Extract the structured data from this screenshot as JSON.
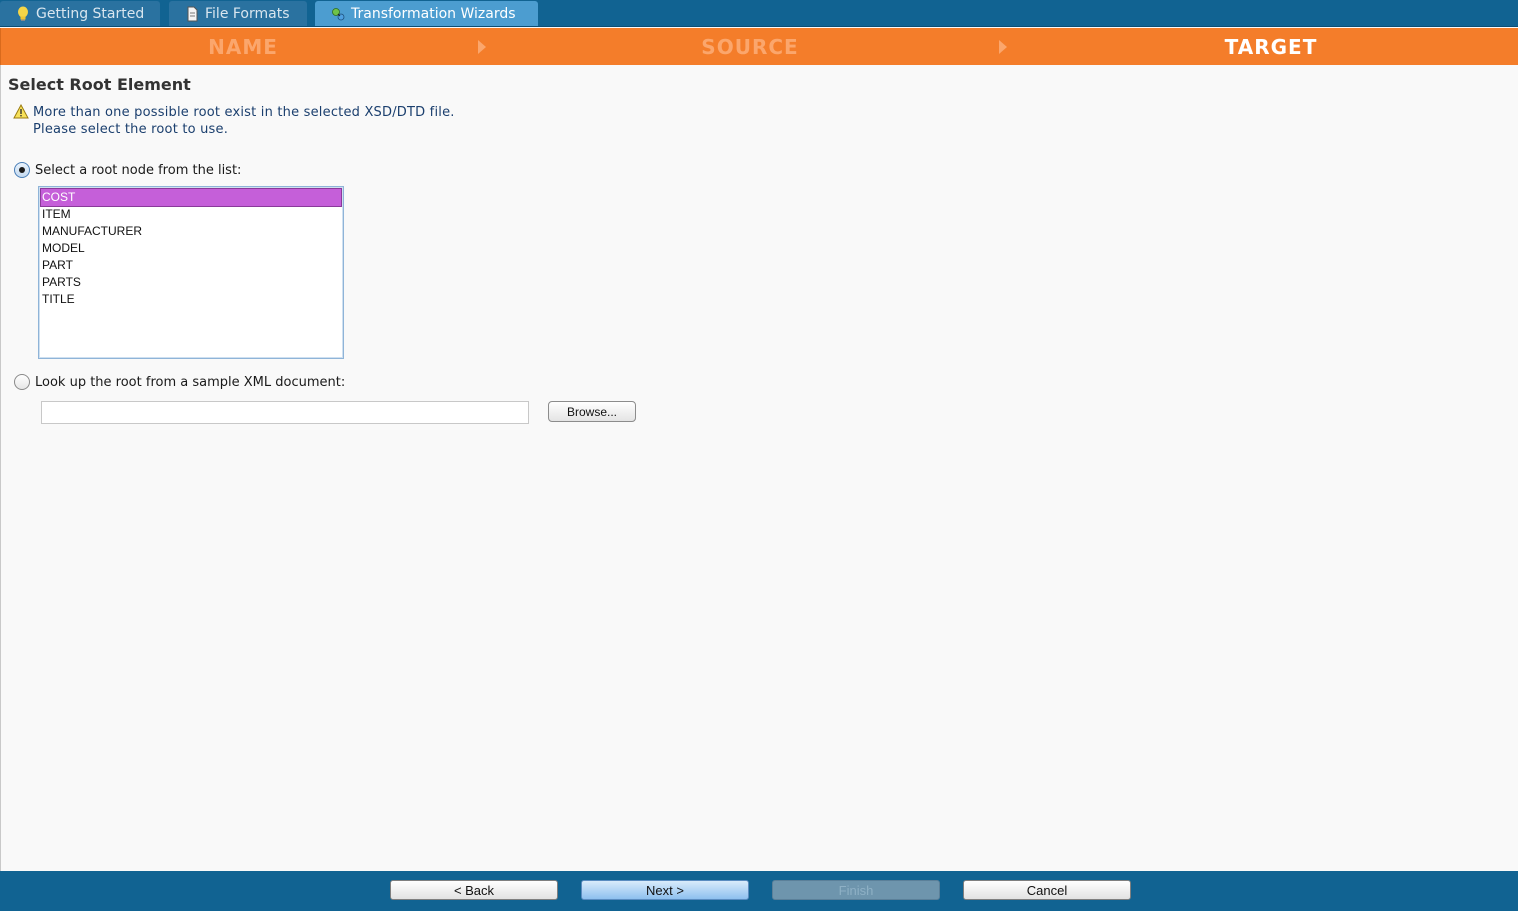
{
  "tabs": [
    {
      "label": "Getting Started",
      "icon": "lightbulb-icon"
    },
    {
      "label": "File Formats",
      "icon": "document-icon"
    },
    {
      "label": "Transformation Wizards",
      "icon": "wizard-icon",
      "active": true
    }
  ],
  "steps": {
    "name": "NAME",
    "source": "SOURCE",
    "target": "TARGET",
    "current": "TARGET"
  },
  "section": {
    "title": "Select Root Element",
    "warning_line1": "More than one possible root exist in the selected XSD/DTD file.",
    "warning_line2": "Please select the root to use."
  },
  "options": {
    "list_label": "Select a root node from the list:",
    "xml_label": "Look up the root from a sample XML document:",
    "selected_option": "list"
  },
  "root_list": {
    "items": [
      "COST",
      "ITEM",
      "MANUFACTURER",
      "MODEL",
      "PART",
      "PARTS",
      "TITLE"
    ],
    "selected": "COST"
  },
  "xml_document": {
    "value": "",
    "browse_label": "Browse..."
  },
  "footer": {
    "back_label": "< Back",
    "next_label": "Next >",
    "finish_label": "Finish",
    "cancel_label": "Cancel"
  },
  "colors": {
    "tabbar": "#116392",
    "stepbar": "#f47d2a",
    "step_inactive": "#fba66c",
    "selection": "#c55fd9"
  }
}
